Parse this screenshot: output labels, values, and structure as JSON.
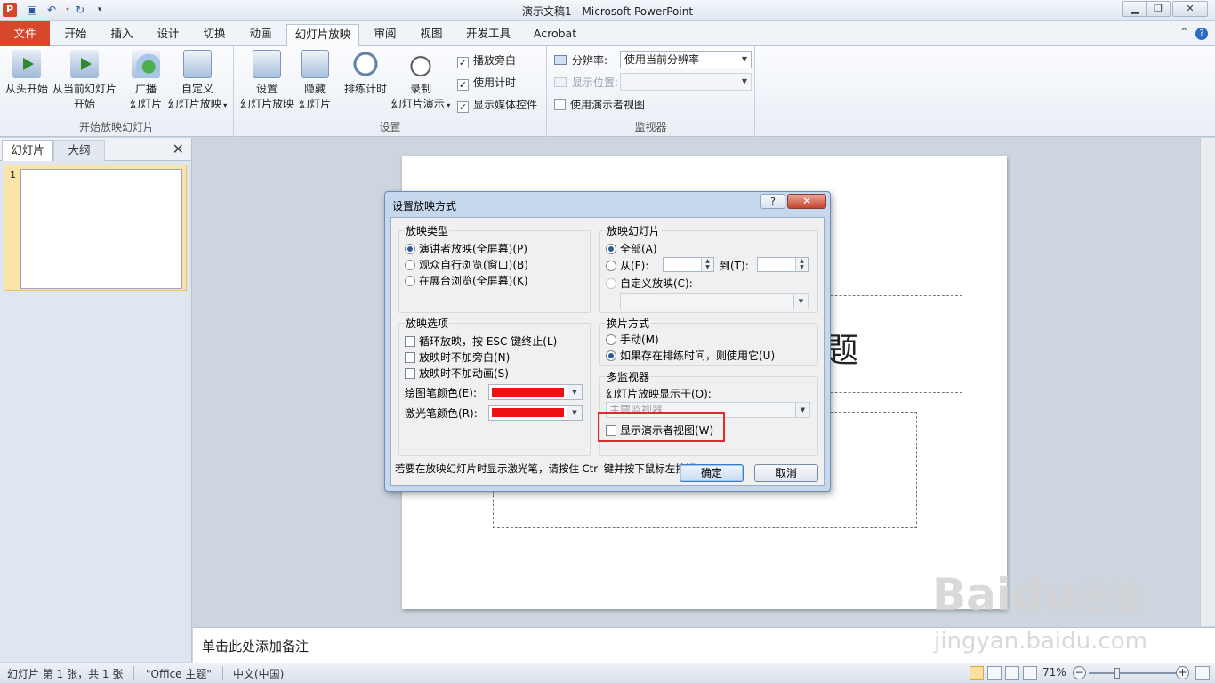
{
  "window": {
    "title": "演示文稿1 - Microsoft PowerPoint",
    "app_icon": "P"
  },
  "ribbon_tabs": [
    "文件",
    "开始",
    "插入",
    "设计",
    "切换",
    "动画",
    "幻灯片放映",
    "审阅",
    "视图",
    "开发工具",
    "Acrobat"
  ],
  "ribbon": {
    "group_start": {
      "label": "开始放映幻灯片",
      "from_start": "从头开始",
      "from_current_1": "从当前幻灯片",
      "from_current_2": "开始",
      "broadcast_1": "广播",
      "broadcast_2": "幻灯片",
      "custom_1": "自定义",
      "custom_2": "幻灯片放映"
    },
    "group_setup": {
      "label": "设置",
      "setup_1": "设置",
      "setup_2": "幻灯片放映",
      "hide_1": "隐藏",
      "hide_2": "幻灯片",
      "rehearse": "排练计时",
      "record_1": "录制",
      "record_2": "幻灯片演示",
      "play_narrations": "播放旁白",
      "use_timings": "使用计时",
      "show_media": "显示媒体控件"
    },
    "group_monitors": {
      "label": "监视器",
      "resolution_label": "分辨率:",
      "resolution_value": "使用当前分辨率",
      "show_on_label": "显示位置:",
      "presenter_view": "使用演示者视图"
    }
  },
  "left_pane": {
    "tab_slides": "幻灯片",
    "tab_outline": "大纲",
    "slide_number": "1"
  },
  "slide": {
    "title_fragment": "题"
  },
  "notes_placeholder": "单击此处添加备注",
  "status": {
    "slide_info": "幻灯片 第 1 张，共 1 张",
    "theme": "\"Office 主题\"",
    "language": "中文(中国)",
    "zoom": "71%"
  },
  "dialog": {
    "title": "设置放映方式",
    "help": "?",
    "close": "✕",
    "show_type": {
      "label": "放映类型",
      "options": [
        "演讲者放映(全屏幕)(P)",
        "观众自行浏览(窗口)(B)",
        "在展台浏览(全屏幕)(K)"
      ],
      "selected_index": 0
    },
    "show_slides": {
      "label": "放映幻灯片",
      "all": "全部(A)",
      "from": "从(F):",
      "to": "到(T):",
      "custom": "自定义放映(C):"
    },
    "show_options": {
      "label": "放映选项",
      "loop": "循环放映，按 ESC 键终止(L)",
      "no_narration": "放映时不加旁白(N)",
      "no_animation": "放映时不加动画(S)",
      "pen_color": "绘图笔颜色(E):",
      "laser_color": "激光笔颜色(R):",
      "pen_color_value": "#ee1111",
      "laser_color_value": "#ee1111"
    },
    "advance": {
      "label": "换片方式",
      "manual": "手动(M)",
      "timings": "如果存在排练时间，则使用它(U)"
    },
    "monitors": {
      "label": "多监视器",
      "display_on": "幻灯片放映显示于(O):",
      "display_value": "主要监视器",
      "presenter_view": "显示演示者视图(W)"
    },
    "hint": "若要在放映幻灯片时显示激光笔，请按住 Ctrl 键并按下鼠标左按钮。",
    "ok": "确定",
    "cancel": "取消"
  },
  "watermark": {
    "brand": "Bai",
    "brand2": "du",
    "brand_cn": "经验",
    "url": "jingyan.baidu.com"
  }
}
